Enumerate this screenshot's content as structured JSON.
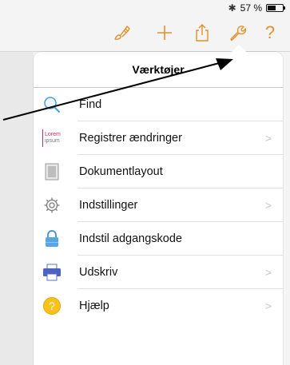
{
  "status": {
    "battery_text": "57 %",
    "battery_level": 0.57
  },
  "toolbar": {
    "buttons": [
      {
        "icon": "brush-icon"
      },
      {
        "icon": "plus-icon"
      },
      {
        "icon": "share-icon"
      },
      {
        "icon": "wrench-icon"
      },
      {
        "icon": "help-icon",
        "label": "?"
      }
    ],
    "accent": "#e0902a"
  },
  "popover": {
    "title": "Værktøjer",
    "items": [
      {
        "label": "Find",
        "icon": "magnifier-icon",
        "chevron": false
      },
      {
        "label": "Registrer ændringer",
        "icon": "lorem-ipsum-icon",
        "icon_text": [
          "Lorem",
          "ipsum"
        ],
        "chevron": true
      },
      {
        "label": "Dokumentlayout",
        "icon": "document-layout-icon",
        "chevron": false
      },
      {
        "label": "Indstillinger",
        "icon": "gear-icon",
        "chevron": true
      },
      {
        "label": "Indstil adgangskode",
        "icon": "lock-icon",
        "chevron": false
      },
      {
        "label": "Udskriv",
        "icon": "printer-icon",
        "chevron": true
      },
      {
        "label": "Hjælp",
        "icon": "help-circle-icon",
        "icon_text": "?",
        "chevron": true
      }
    ]
  }
}
